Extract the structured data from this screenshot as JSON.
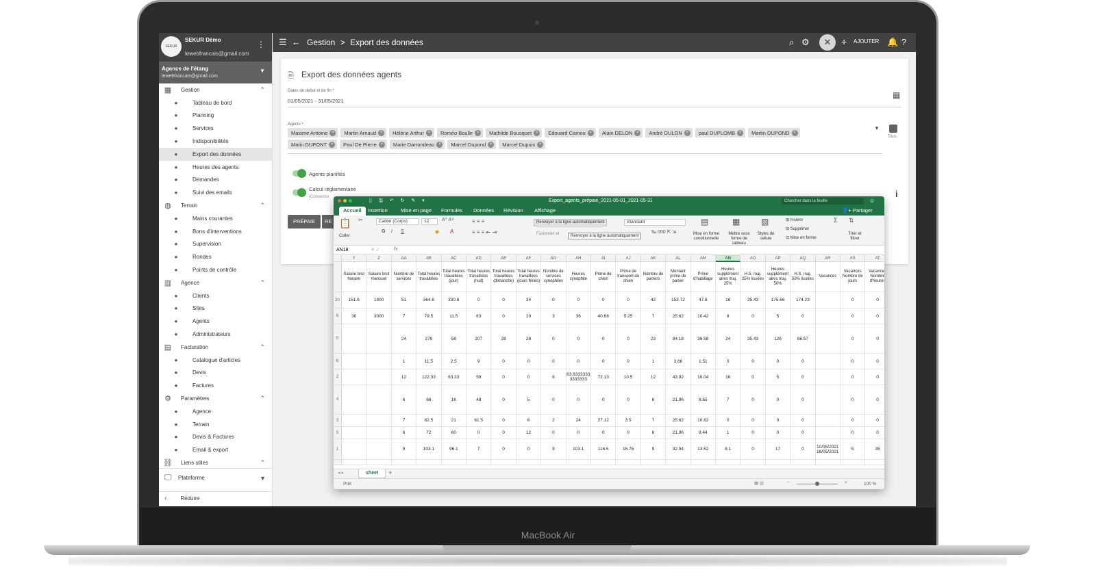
{
  "device": {
    "brand": "MacBook Air"
  },
  "sidebar": {
    "company": "SEKUR Démo",
    "email": "lewebfrancais@gmail.com",
    "logo_text": "SEKUR",
    "agency_name": "Agence de l'étang",
    "agency_email": "lewebfrancais@gmail.com",
    "groups": [
      {
        "label": "Gestion",
        "icon": "calendar-icon",
        "items": [
          "Tableau de bord",
          "Planning",
          "Services",
          "Indisponibilités",
          "Export des données",
          "Heures des agents",
          "Demandes",
          "Suivi des emails"
        ]
      },
      {
        "label": "Terrain",
        "icon": "globe-icon",
        "items": [
          "Mains courantes",
          "Bons d'interventions",
          "Supervision",
          "Rondes",
          "Points de contrôle"
        ]
      },
      {
        "label": "Agence",
        "icon": "building-icon",
        "items": [
          "Clients",
          "Sites",
          "Agents",
          "Administrateurs"
        ]
      },
      {
        "label": "Facturation",
        "icon": "file-icon",
        "items": [
          "Catalogue d'articles",
          "Devis",
          "Factures"
        ]
      },
      {
        "label": "Paramètres",
        "icon": "gears-icon",
        "items": [
          "Agence",
          "Terrain",
          "Devis & Factures",
          "Email & export"
        ]
      },
      {
        "label": "Liens utiles",
        "icon": "link-icon",
        "items": []
      }
    ],
    "active_item": "Export des données",
    "platform_label": "Plateforme",
    "reduce_label": "Réduire"
  },
  "topbar": {
    "crumb_root": "Gestion",
    "crumb_sep": ">",
    "crumb_page": "Export des données",
    "add_label": "AJOUTER"
  },
  "export": {
    "title": "Export des données agents",
    "date_label": "Dates de début et de fin *",
    "date_value": "01/05/2021 - 31/05/2021",
    "agents_label": "Agents *",
    "agents": [
      "Maxime Antoine",
      "Martin Arnaud",
      "Hélène Arthur",
      "Roméo Boulle",
      "Mathilde Bousquet",
      "Edouard Camou",
      "Alain DELON",
      "André DULON",
      "paul DUPLOMB",
      "Martin DUPOND",
      "Matin DUPONT",
      "Paul De Pierre",
      "Marie Darrondeau",
      "Marcel Dupond",
      "Marcel Dupuis"
    ],
    "all_label": "Tous",
    "toggle1_label": "Agents planifiés",
    "toggle2_label": "Calcul réglementaire",
    "toggle2_sub": "(Conventio",
    "prepaie_label": "PRÉPAIE",
    "re_label": "RE"
  },
  "excel": {
    "filename": "Export_agents_prépaie_2021-05-01_2021-05-31",
    "search_placeholder": "Chercher dans la feuille",
    "tabs": [
      "Accueil",
      "Insertion",
      "Mise en page",
      "Formules",
      "Données",
      "Révision",
      "Affichage"
    ],
    "active_tab": "Accueil",
    "share_label": "Partager",
    "ribbon": {
      "paste": "Coller",
      "font": "Calibri (Corps)",
      "size": "12",
      "wrap": "Renvoyer à la ligne automatiquement",
      "merge": "Fusionner et",
      "tooltip": "Renvoyer à la ligne automatiquement",
      "format": "Standard",
      "cond_format": "Mise en forme conditionnelle",
      "table_format": "Mettre sous forme de tableau",
      "cell_styles": "Styles de cellule",
      "insert": "Insérer",
      "delete": "Supprimer",
      "format_menu": "Mise en forme",
      "sort": "Trier et filtrer"
    },
    "cell_ref": "AN18",
    "fx": "fx",
    "columns": [
      "Y",
      "Z",
      "AA",
      "AB",
      "AC",
      "AD",
      "AE",
      "AF",
      "AG",
      "AH",
      "AI",
      "AJ",
      "AK",
      "AL",
      "AM",
      "AN",
      "AO",
      "AP",
      "AQ",
      "AR",
      "AS",
      "AT"
    ],
    "selected_column": "AN",
    "headers": [
      "Salaire brut horaire",
      "Salaire brut mensuel",
      "Nombre de services",
      "Total heures travaillées",
      "Total heures travaillées (jour)",
      "Total heures travaillées (nuit)",
      "Total heures travaillées (dimanche)",
      "Total heures travaillées (jours fériés)",
      "Nombre de services cynophiles",
      "Heures cynophile",
      "Prime de chien",
      "Prime de transport du chien",
      "Nombre de paniers",
      "Montant prime de panier",
      "Prime d'habillage",
      "Heures supplément aires maj. 25%",
      "H.S. maj. 25% lissées",
      "Heures supplément aires maj. 50%",
      "H.S. maj. 50% lissées",
      "Vacances",
      "Vacances Nombre de jours",
      "Vacances Nombre d'heures"
    ],
    "row_numbers": [
      "20",
      "8",
      "5",
      "6",
      "2",
      "4",
      "3",
      "5",
      "1",
      ""
    ],
    "rows": [
      [
        "151.6",
        "1800",
        "51",
        "364.6",
        "330.6",
        "0",
        "0",
        "34",
        "0",
        "0",
        "0",
        "0",
        "42",
        "153.72",
        "47.8",
        "16",
        "35.43",
        "175.66",
        "174.23",
        "",
        "0",
        "0"
      ],
      [
        "30",
        "3000",
        "7",
        "79.5",
        "11.5",
        "63",
        "0",
        "20",
        "3",
        "36",
        "40.68",
        "5.25",
        "7",
        "25.62",
        "10.42",
        "8",
        "0",
        "5",
        "0",
        "",
        "0",
        "0"
      ],
      [
        "",
        "",
        "24",
        "279",
        "58",
        "207",
        "28",
        "28",
        "0",
        "0",
        "0",
        "0",
        "23",
        "84.18",
        "36.58",
        "24",
        "35.43",
        "126",
        "88.57",
        "",
        "0",
        "0"
      ],
      [
        "",
        "",
        "1",
        "11.5",
        "2.5",
        "9",
        "0",
        "0",
        "0",
        "0",
        "0",
        "0",
        "1",
        "3.66",
        "1.51",
        "0",
        "0",
        "0",
        "0",
        "",
        "0",
        "0"
      ],
      [
        "",
        "",
        "12",
        "122.33",
        "63.33",
        "59",
        "0",
        "0",
        "6",
        "63.8333333 3333333",
        "72.13",
        "10.5",
        "12",
        "43.92",
        "16.04",
        "16",
        "0",
        "5",
        "0",
        "",
        "0",
        "0"
      ],
      [
        "",
        "",
        "6",
        "66",
        "16",
        "48",
        "0",
        "5",
        "0",
        "0",
        "0",
        "0",
        "6",
        "21.96",
        "8.65",
        "7",
        "0",
        "0",
        "0",
        "",
        "0",
        "0"
      ],
      [
        "",
        "",
        "7",
        "82.5",
        "21",
        "61.5",
        "0",
        "6",
        "2",
        "24",
        "27.12",
        "3.5",
        "7",
        "25.62",
        "10.82",
        "0",
        "0",
        "0",
        "0",
        "",
        "0",
        "0"
      ],
      [
        "",
        "",
        "6",
        "72",
        "60",
        "0",
        "0",
        "12",
        "0",
        "0",
        "0",
        "0",
        "6",
        "21.96",
        "9.44",
        "1",
        "0",
        "0",
        "0",
        "",
        "0",
        "0"
      ],
      [
        "",
        "",
        "9",
        "103.1",
        "96.1",
        "7",
        "0",
        "0",
        "9",
        "103.1",
        "116.5",
        "15.75",
        "9",
        "32.94",
        "13.52",
        "8.1",
        "0",
        "17",
        "0",
        "10/05/2021 16/05/2021",
        "5",
        "35"
      ],
      [
        "",
        "",
        "",
        "",
        "",
        "",
        "",
        "",
        "",
        "",
        "",
        "",
        "",
        "",
        "",
        "",
        "",
        "",
        "",
        "",
        "",
        ""
      ]
    ],
    "sheet_name": "sheet",
    "status": "Prêt",
    "zoom": "100 %"
  }
}
